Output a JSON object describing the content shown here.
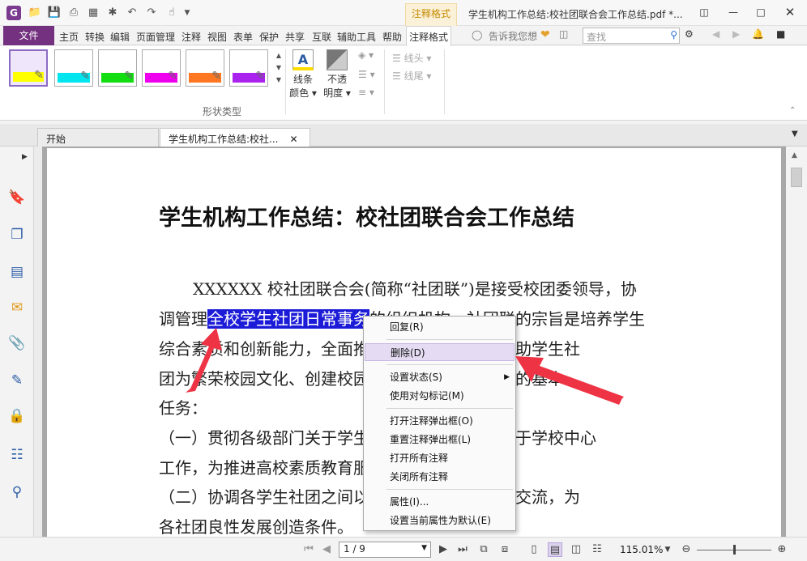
{
  "window": {
    "title": "学生机构工作总结:校社团联合会工作总结.pdf *...",
    "context_tab_group": "注释格式",
    "app_logo": "G"
  },
  "menu": {
    "file": "文件",
    "items": [
      "主页",
      "转换",
      "编辑",
      "页面管理",
      "注释",
      "视图",
      "表单",
      "保护",
      "共享",
      "互联",
      "辅助工具",
      "帮助",
      "注释格式"
    ],
    "tell_me": "告诉我您想",
    "search_placeholder": "查找"
  },
  "ribbon": {
    "swatch_colors": [
      "#ffff00",
      "#00e5ee",
      "#11dd11",
      "#ee00ee",
      "#ff7722",
      "#aa22ee"
    ],
    "line_color_label": "线条",
    "line_color_label2": "颜色",
    "opacity_label": "不透",
    "opacity_label2": "明度",
    "line_start": "线头",
    "line_end": "线尾",
    "group_label": "形状类型"
  },
  "tabs": {
    "start": "开始",
    "document": "学生机构工作总结:校社..."
  },
  "document": {
    "title": "学生机构工作总结：校社团联合会工作总结",
    "line1": "XXXXXX 校社团联合会(简称“社团联”)是接受校团委领导，协",
    "line2_pre": "调管理",
    "line2_highlight": "全校学生社团日常事务",
    "line2_post": "的组织机构。社团联的宗旨是培养学生",
    "line3": "综合素质和创新能力，全面推进学生健康发展，协助学生社",
    "line4": "团为繁荣校园文化、创建校园文明做贡献。社团联的基本",
    "line5": "任务：",
    "line6": "（一）贯彻各级部门关于学生社团工作指示，服务于学校中心",
    "line7": "工作，为推进高校素质教育服务；",
    "line8": "（二）协调各学生社团之间以及社团之间的联系和交流，为",
    "line9": "各社团良性发展创造条件。"
  },
  "context_menu": {
    "items": [
      {
        "label": "回复(R)"
      },
      {
        "label": "删除(D)"
      },
      {
        "label": "设置状态(S)"
      },
      {
        "label": "使用对勾标记(M)"
      },
      {
        "label": "打开注释弹出框(O)"
      },
      {
        "label": "重置注释弹出框(L)"
      },
      {
        "label": "打开所有注释"
      },
      {
        "label": "关闭所有注释"
      },
      {
        "label": "属性(I)..."
      },
      {
        "label": "设置当前属性为默认(E)"
      }
    ],
    "highlight_color": "#e5dcf3"
  },
  "statusbar": {
    "page_indicator": "1 / 9",
    "zoom": "115.01%",
    "zoom_fraction": 0.5
  },
  "colors": {
    "accent": "#73317f",
    "highlight_text": "#1c1cd8",
    "annotation_arrow": "#ee3344"
  }
}
